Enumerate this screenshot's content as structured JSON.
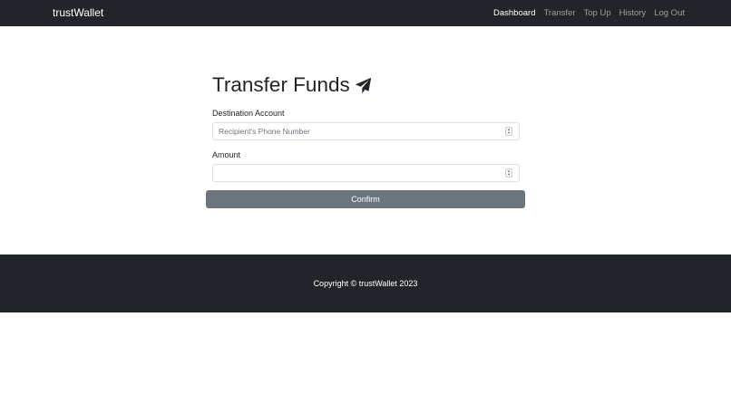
{
  "navbar": {
    "brand": "trustWallet",
    "links": [
      {
        "label": "Dashboard",
        "active": true
      },
      {
        "label": "Transfer",
        "active": false
      },
      {
        "label": "Top Up",
        "active": false
      },
      {
        "label": "History",
        "active": false
      },
      {
        "label": "Log Out",
        "active": false
      }
    ]
  },
  "page": {
    "title": "Transfer Funds",
    "title_icon": "paper-plane-icon"
  },
  "form": {
    "destination": {
      "label": "Destination Account",
      "value": "",
      "placeholder": "Recipient's Phone Number"
    },
    "amount": {
      "label": "Amount",
      "value": "",
      "placeholder": ""
    },
    "confirm_label": "Confirm"
  },
  "footer": {
    "text": "Copyright © trustWallet 2023"
  },
  "colors": {
    "nav_bg": "#212529",
    "button_bg": "#6c757d",
    "text": "#212529"
  }
}
